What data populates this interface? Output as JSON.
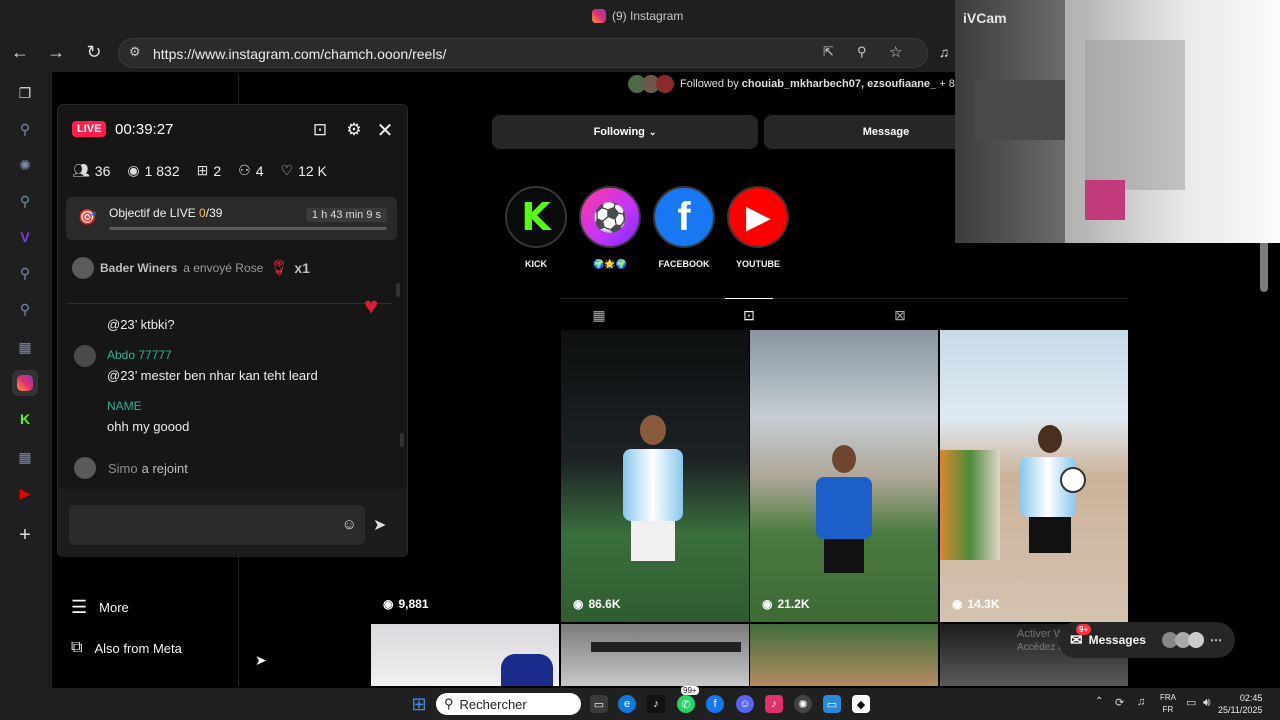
{
  "browser": {
    "tab_title": "(9) Instagram",
    "url": "https://www.instagram.com/chamch.ooon/reels/"
  },
  "live_panel": {
    "badge": "LIVE",
    "timer": "00:39:27",
    "stats": {
      "participants": "36",
      "views": "1 832",
      "gifts": "2",
      "guests": "4",
      "likes": "12 K"
    },
    "goal": {
      "label": "Objectif de LIVE ",
      "current": "0",
      "target": "/39",
      "time_left": "1 h 43 min 9 s",
      "progress": 0
    },
    "gift_event": {
      "user": "Bader Winers",
      "action": "a envoyé Rose",
      "count": "x1"
    },
    "comments": [
      {
        "name": "",
        "text": "@23’ ktbki?"
      },
      {
        "name": "Abdo 77777",
        "text": "@23’ mester ben nhar kan teht leard"
      },
      {
        "name": "NAME",
        "text": "ohh my goood"
      }
    ],
    "join_event": {
      "user": "Simo",
      "action": "a rejoint"
    }
  },
  "instagram_sidebar": {
    "more_label": "More",
    "meta_label": "Also from Meta"
  },
  "profile": {
    "followed_by_prefix": "Followed by ",
    "followed_by_names": "chouiab_mkharbech07, ezsoufiaane_",
    "followed_by_suffix": " + 8",
    "following_label": "Following",
    "message_label": "Message",
    "highlights": [
      {
        "label": "KICK",
        "icon": "kick-logo-icon"
      },
      {
        "label": "🌍🌟🌍",
        "icon": "football-player-icon"
      },
      {
        "label": "FACEBOOK",
        "icon": "facebook-logo-icon"
      },
      {
        "label": "YOUTUBE",
        "icon": "youtube-logo-icon"
      }
    ]
  },
  "reels": [
    {
      "views": "9,881"
    },
    {
      "views": "86.6K"
    },
    {
      "views": "21.2K"
    },
    {
      "views": "14.3K"
    }
  ],
  "messages_pill": {
    "label": "Messages",
    "badge": "9+"
  },
  "watermark": {
    "line1": "Activer Windows",
    "line2": "Accédez aux paramètres pour activer Windows."
  },
  "webcam": {
    "label": "iVCam"
  },
  "taskbar": {
    "search_label": "Rechercher",
    "lang_top": "FRA",
    "lang_bottom": "FR",
    "time": "02:45",
    "date": "25/11/2025",
    "whatsapp_badge": "99+"
  },
  "colors": {
    "live_red": "#ff1f4b",
    "comment_name": "#2db395",
    "goal_yellow": "#f7c842"
  }
}
